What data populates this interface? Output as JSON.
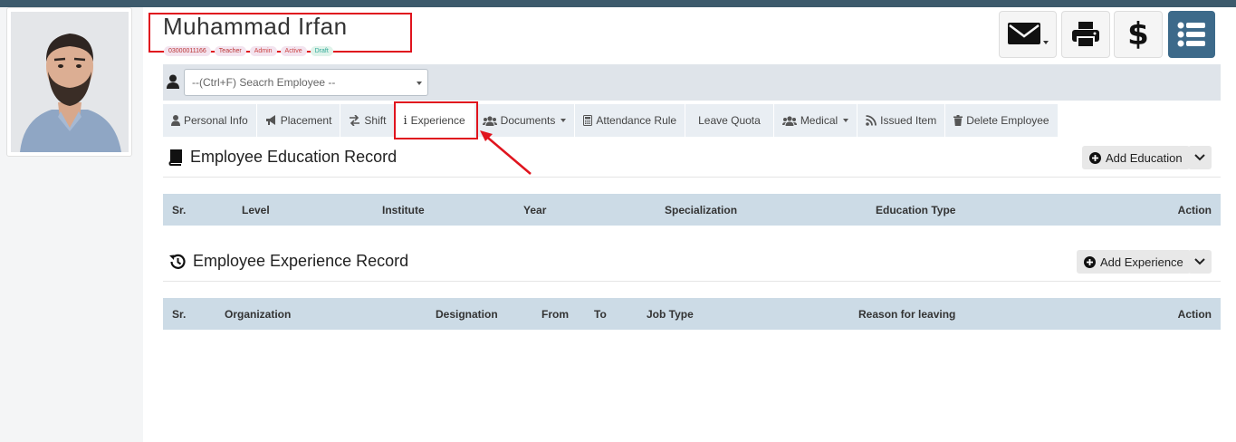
{
  "employee": {
    "name": "Muhammad Irfan",
    "badges": [
      "03000011166",
      "Teacher",
      "Admin",
      "Active",
      "Draft"
    ]
  },
  "search": {
    "placeholder": "--(Ctrl+F) Seacrh Employee --"
  },
  "tabs": [
    {
      "label": "Personal Info",
      "icon": "user-icon"
    },
    {
      "label": "Placement",
      "icon": "bullhorn-icon"
    },
    {
      "label": "Shift",
      "icon": "exchange-icon"
    },
    {
      "label": "Experience",
      "icon": "info-icon"
    },
    {
      "label": "Documents",
      "icon": "users-icon"
    },
    {
      "label": "Attendance Rule",
      "icon": "calculator-icon"
    },
    {
      "label": "Leave Quota",
      "icon": ""
    },
    {
      "label": "Medical",
      "icon": "users-icon"
    },
    {
      "label": "Issued Item",
      "icon": "rss-icon"
    },
    {
      "label": "Delete Employee",
      "icon": "trash-icon"
    }
  ],
  "education": {
    "title": "Employee Education Record",
    "add_label": "Add Education",
    "columns": [
      "Sr.",
      "Level",
      "Institute",
      "Year",
      "Specialization",
      "Education Type",
      "Action"
    ]
  },
  "experience": {
    "title": "Employee Experience Record",
    "add_label": "Add Experience",
    "columns": [
      "Sr.",
      "Organization",
      "Designation",
      "From",
      "To",
      "Job Type",
      "Reason for leaving",
      "Action"
    ]
  },
  "colors": {
    "accent": "#3d6a8a",
    "highlight": "#e0141e",
    "table_header": "#ccdbe6"
  }
}
